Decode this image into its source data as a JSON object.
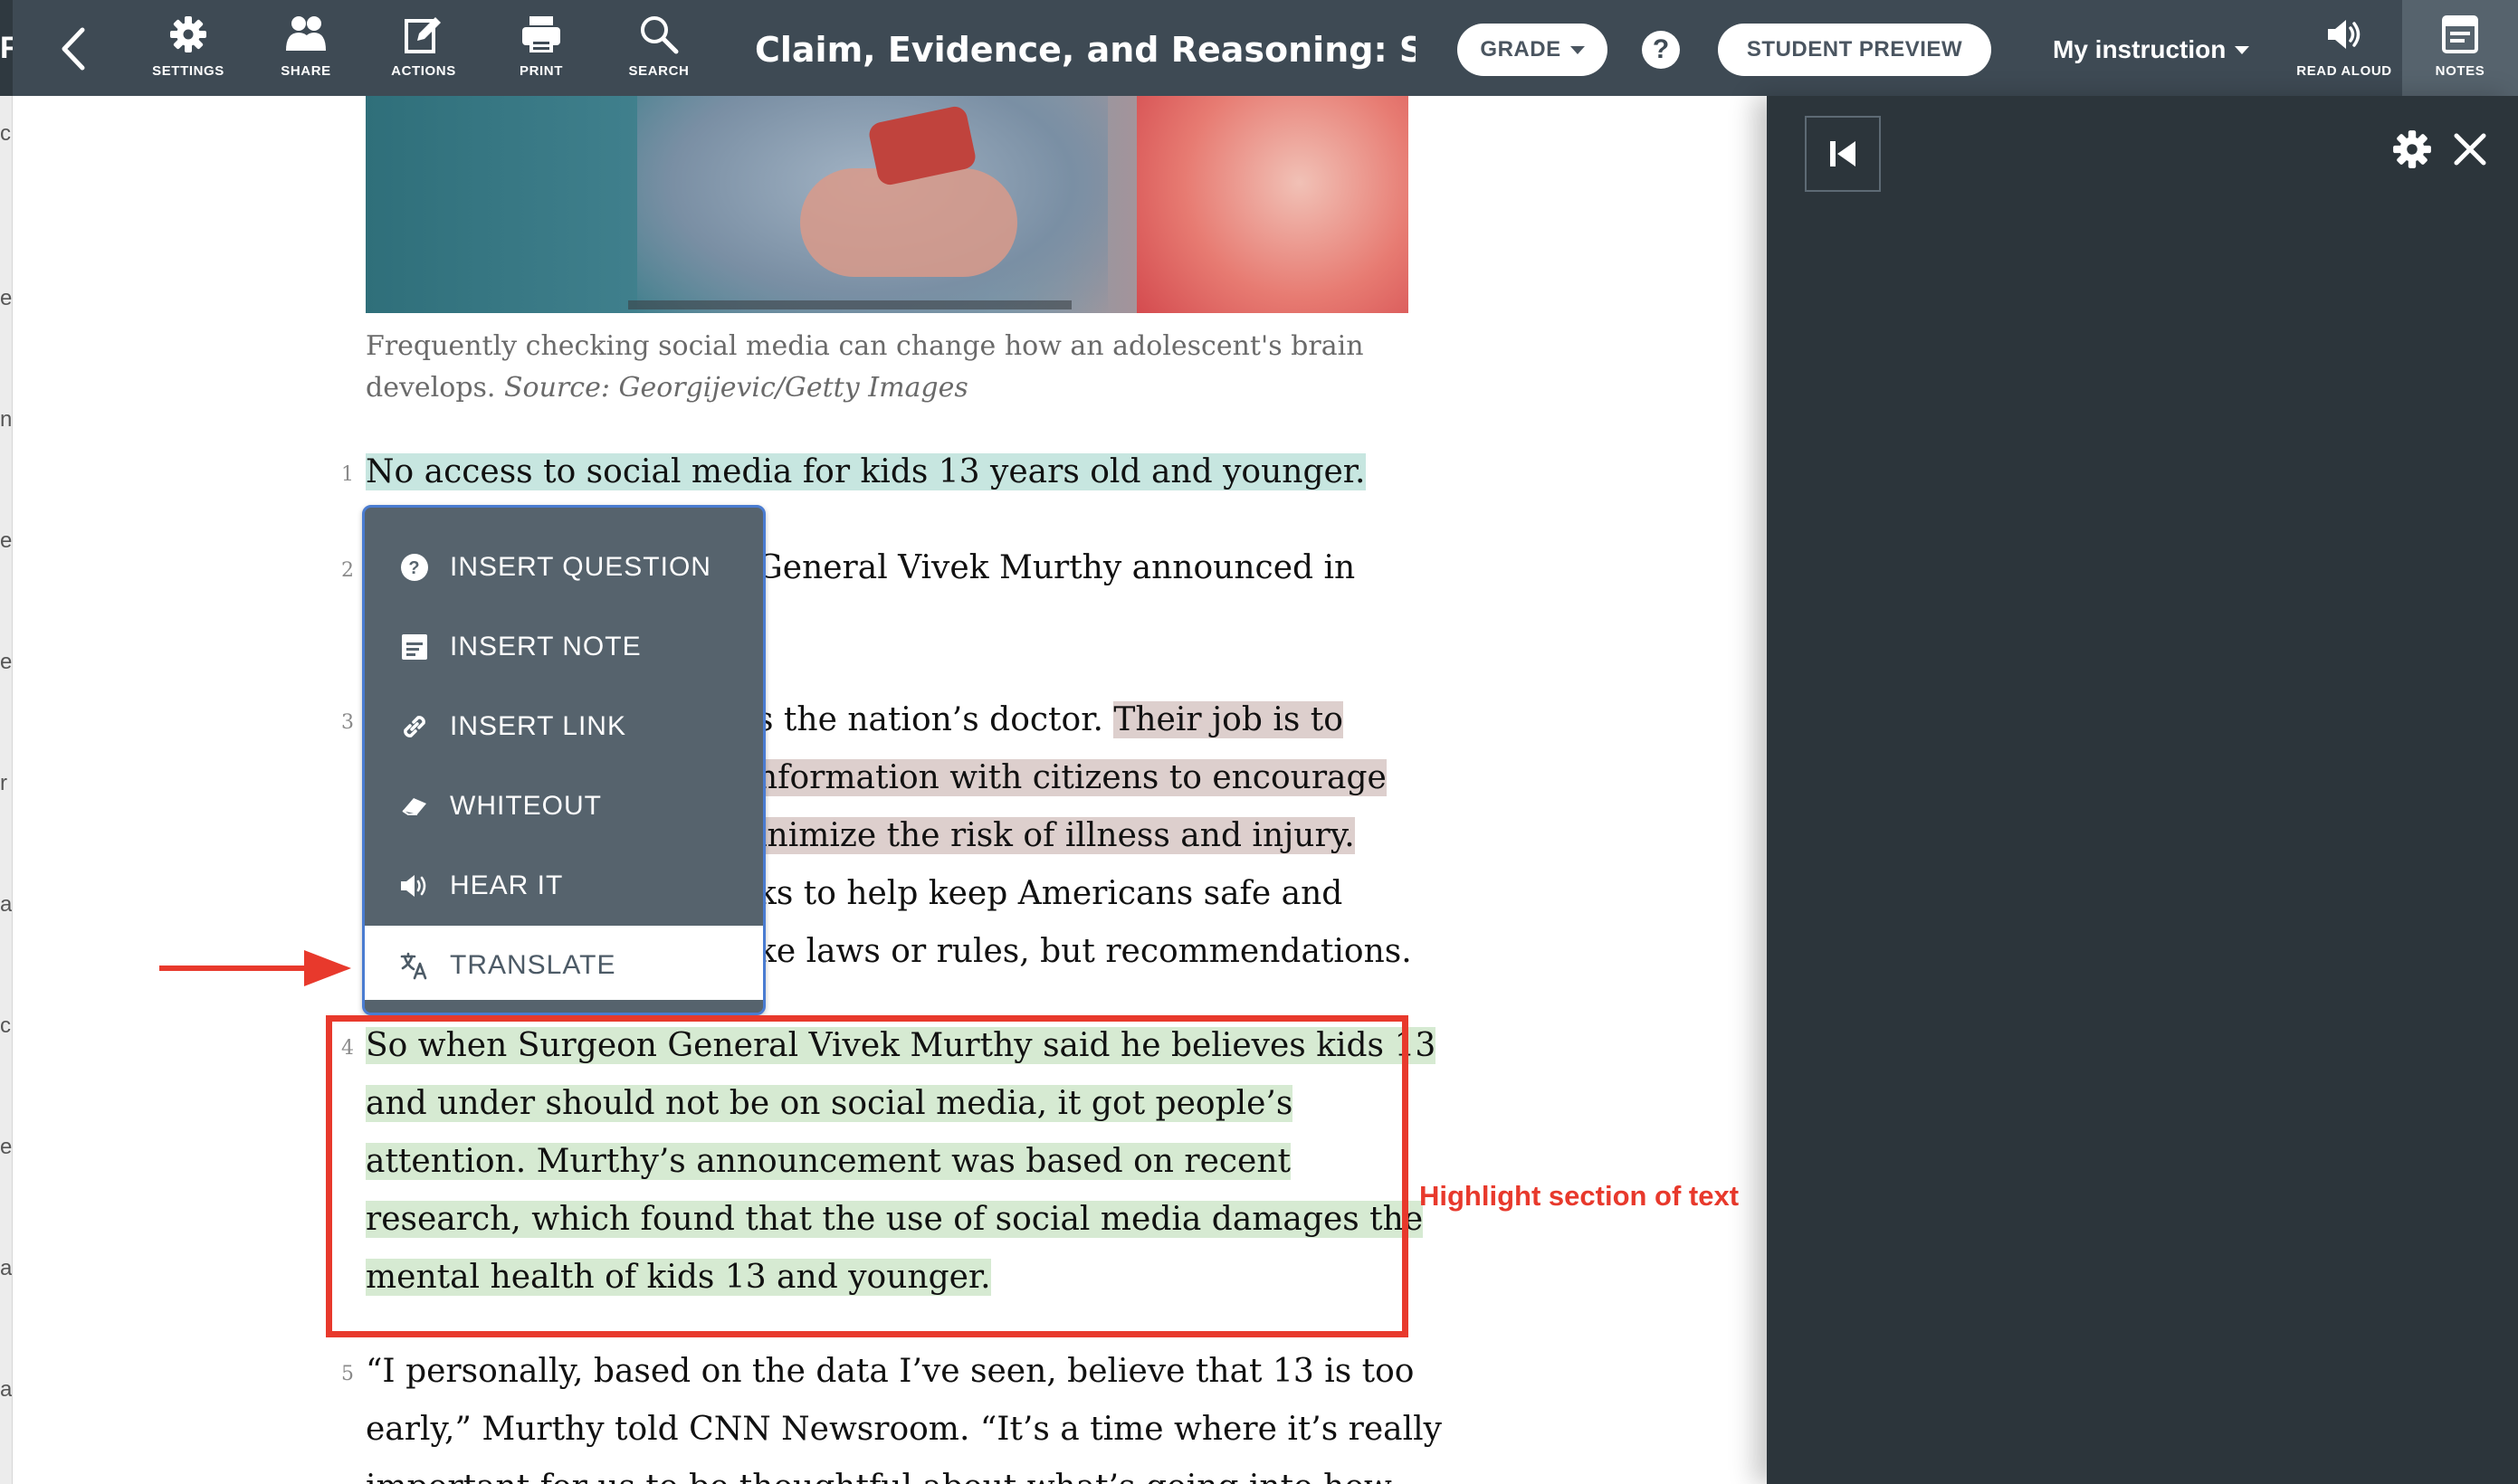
{
  "toolbar": {
    "edge_letter": "F",
    "back_icon": "chevron-left-icon",
    "tools": [
      {
        "label": "SETTINGS",
        "icon": "gear-icon"
      },
      {
        "label": "SHARE",
        "icon": "people-icon"
      },
      {
        "label": "ACTIONS",
        "icon": "edit-icon"
      },
      {
        "label": "PRINT",
        "icon": "printer-icon"
      },
      {
        "label": "SEARCH",
        "icon": "search-icon"
      }
    ],
    "title": "Claim, Evidence, and Reasoning: S...",
    "grade_label": "GRADE",
    "help_label": "?",
    "student_preview_label": "STUDENT PREVIEW",
    "instruction_label": "My instruction",
    "read_aloud_label": "READ ALOUD",
    "notes_label": "NOTES"
  },
  "left_strip": {
    "letters": [
      "c",
      "e",
      "n",
      "e",
      "e",
      "r",
      "a",
      "c",
      "e",
      "a",
      "a"
    ]
  },
  "article": {
    "image_alt": "Teen holding a phone",
    "caption_text": "Frequently checking social media can change how an adolescent's brain develops.",
    "caption_source": "Source: Georgijevic/Getty Images",
    "paragraphs": [
      {
        "num": "1",
        "lines": [
          "No access to social media for kids 13 years old and younger."
        ]
      },
      {
        "num": "2",
        "lines": [
          "General Vivek Murthy announced in",
          ""
        ]
      },
      {
        "num": "3",
        "lines": [
          "s the nation’s doctor. ",
          "Their job is to",
          "nformation with citizens to encourage",
          "inimize the risk of illness and injury.",
          "ks to help keep Americans safe and",
          "ke laws or rules, but recommendations."
        ]
      },
      {
        "num": "4",
        "lines": [
          "So when Surgeon General Vivek Murthy said he believes kids 13",
          "and under should not be on social media, it got people’s",
          "attention. Murthy’s announcement was based on recent",
          "research, which found that the use of social media damages the",
          "mental health of kids 13 and younger."
        ]
      },
      {
        "num": "5",
        "lines": [
          "“I personally, based on the data I’ve seen, believe that 13 is too",
          "early,” Murthy told CNN Newsroom. “It’s a time where it’s really",
          "important for us to be thoughtful about what’s going into how"
        ]
      }
    ]
  },
  "context_menu": {
    "items": [
      {
        "label": "INSERT QUESTION",
        "icon": "question-circle-icon"
      },
      {
        "label": "INSERT NOTE",
        "icon": "note-icon"
      },
      {
        "label": "INSERT LINK",
        "icon": "link-icon"
      },
      {
        "label": "WHITEOUT",
        "icon": "eraser-icon"
      },
      {
        "label": "HEAR IT",
        "icon": "speaker-icon"
      },
      {
        "label": "TRANSLATE",
        "icon": "translate-icon"
      }
    ],
    "active_item": "TRANSLATE"
  },
  "annotations": {
    "highlight_label": "Highlight section of text",
    "color": "#e8392c"
  },
  "notes_panel": {
    "collapse_icon": "skip-back-icon",
    "settings_icon": "gear-icon",
    "close_icon": "close-icon"
  },
  "colors": {
    "toolbar": "#3e4a54",
    "menu": "#56636d",
    "panel": "#2c353b",
    "highlight_teal": "#c7e6e0",
    "highlight_mauve": "#ddcfcd",
    "highlight_green": "#d6ead2"
  }
}
